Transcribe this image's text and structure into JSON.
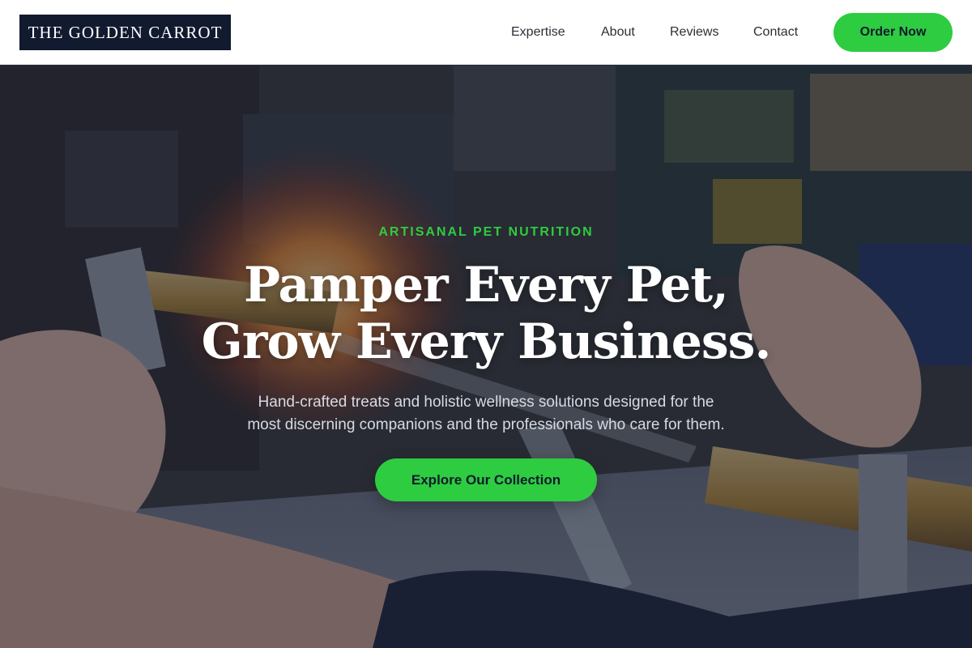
{
  "header": {
    "logo_text": "THE GOLDEN CARROT",
    "nav": [
      {
        "label": "Expertise"
      },
      {
        "label": "About"
      },
      {
        "label": "Reviews"
      },
      {
        "label": "Contact"
      }
    ],
    "cta_label": "Order Now"
  },
  "hero": {
    "eyebrow": "ARTISANAL PET NUTRITION",
    "headline_lines": [
      "Pamper Every Pet,",
      "Grow Every Business."
    ],
    "subtext_lines": [
      "Hand-crafted treats and holistic wellness solutions designed for the",
      "most discerning companions and the professionals who care for them."
    ],
    "cta_label": "Explore Our Collection"
  },
  "colors": {
    "accent": "#2ecc40",
    "brand_dark": "#111a2e",
    "header_bg": "#ffffff",
    "nav_text": "#2b2f36",
    "hero_text": "#ffffff",
    "hero_subtext": "#d6dae2",
    "eyebrow_text": "#2ecc40"
  }
}
